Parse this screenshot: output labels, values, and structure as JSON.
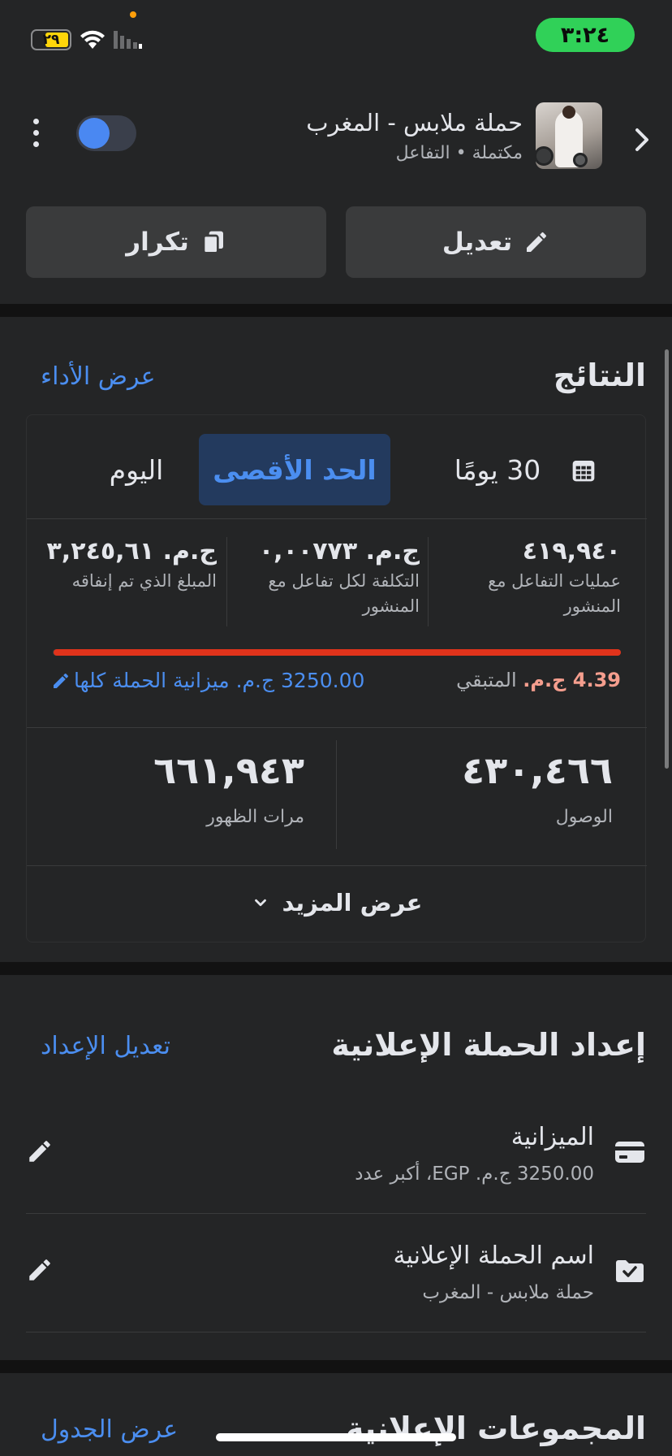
{
  "status_bar": {
    "time": "٣:٢٤",
    "battery": "٢٩",
    "colors": {
      "time_pill": "#30d158",
      "battery": "#ffd60a"
    }
  },
  "header": {
    "campaign_title": "حملة ملابس - المغرب",
    "status": "مكتملة",
    "separator": "•",
    "objective": "التفاعل",
    "edit_label": "تعديل",
    "duplicate_label": "تكرار",
    "toggle_on": true
  },
  "results": {
    "title": "النتائج",
    "view_performance": "عرض الأداء",
    "tabs": {
      "last30": "30 يومًا",
      "maximum": "الحد الأقصى",
      "today": "اليوم"
    },
    "metrics": [
      {
        "value": "٤١٩,٩٤٠",
        "label": "عمليات  التفاعل مع المنشور"
      },
      {
        "value": "ج.م. ٠,٠٠٧٧٣",
        "label": "التكلفة لكل تفاعل مع المنشور"
      },
      {
        "value": "ج.م. ٣,٢٤٥,٦١",
        "label": "المبلغ الذي تم إنفاقه"
      }
    ],
    "budget_progress": 0.9986,
    "remaining_amount": "4.39 ج.م.",
    "remaining_label": "المتبقي",
    "lifetime_budget": "3250.00 ج.م. ميزانية الحملة كلها",
    "reach_value": "٤٣٠,٤٦٦",
    "reach_label": "الوصول",
    "impressions_value": "٦٦١,٩٤٣",
    "impressions_label": "مرات الظهور",
    "see_more": "عرض المزيد"
  },
  "setup": {
    "title": "إعداد الحملة الإعلانية",
    "edit_setup": "تعديل الإعداد",
    "budget_title": "الميزانية",
    "budget_sub": "3250.00 ج.م. EGP، أكبر عدد",
    "name_title": "اسم الحملة الإعلانية",
    "name_sub": "حملة ملابس - المغرب"
  },
  "adsets": {
    "title": "المجموعات الإعلانية",
    "view_table": "عرض الجدول"
  },
  "colors": {
    "accent": "#4b8ef0",
    "progress": "#e0331b",
    "background": "#242526"
  }
}
